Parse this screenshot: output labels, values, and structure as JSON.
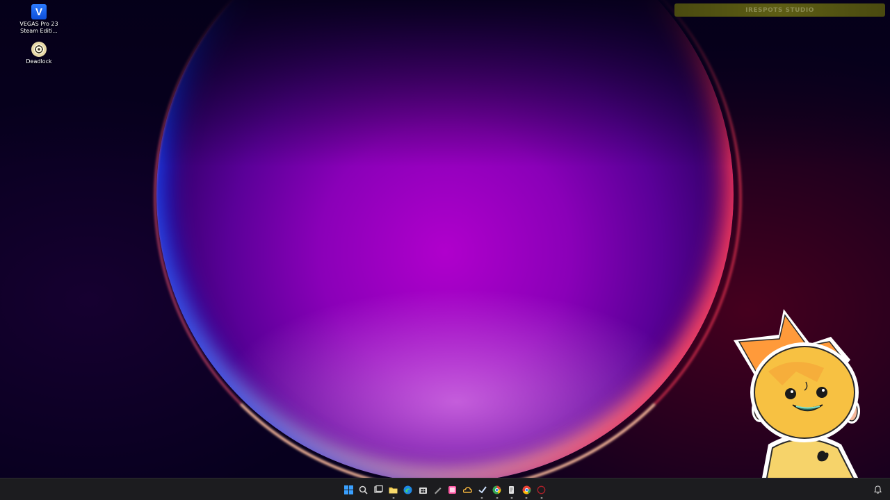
{
  "desktop": {
    "icons": [
      {
        "label": "VEGAS Pro 23\nSteam Editi...",
        "glyph": "V",
        "icon": "vegas-pro-icon"
      },
      {
        "label": "Deadlock",
        "icon": "deadlock-icon"
      }
    ],
    "overlay_banner": {
      "text": "IRESPOTS STUDIO"
    },
    "mascot": "yellow-cartoon-character"
  },
  "taskbar": {
    "pinned": [
      {
        "name": "start",
        "icon": "windows-start-icon",
        "color": "#3aa0ff"
      },
      {
        "name": "search",
        "icon": "search-icon",
        "color": "#d8d8d8"
      },
      {
        "name": "task-view",
        "icon": "task-view-icon",
        "color": "#d8d8d8"
      },
      {
        "name": "file-explorer",
        "icon": "folder-icon",
        "color": "#f2c94c"
      },
      {
        "name": "edge",
        "icon": "edge-icon",
        "color": "#29b6f6"
      },
      {
        "name": "store",
        "icon": "store-icon",
        "color": "#d8d8d8"
      },
      {
        "name": "app",
        "icon": "pen-icon",
        "color": "#9a9a9a"
      },
      {
        "name": "app",
        "icon": "gallery-icon",
        "color": "#ff5aa5"
      },
      {
        "name": "onedrive",
        "icon": "cloud-icon",
        "color": "#f2b33d"
      },
      {
        "name": "steam",
        "icon": "steam-icon",
        "color": "#cfe3ff"
      },
      {
        "name": "chrome",
        "icon": "chrome-icon",
        "color": "#34a853"
      },
      {
        "name": "notepad",
        "icon": "notepad-icon",
        "color": "#e0e0e0"
      },
      {
        "name": "chrome",
        "icon": "chrome-icon",
        "color": "#ea4335"
      },
      {
        "name": "obs",
        "icon": "record-icon",
        "color": "#b0202a"
      }
    ],
    "notification_icon": "notification-bell-icon"
  }
}
